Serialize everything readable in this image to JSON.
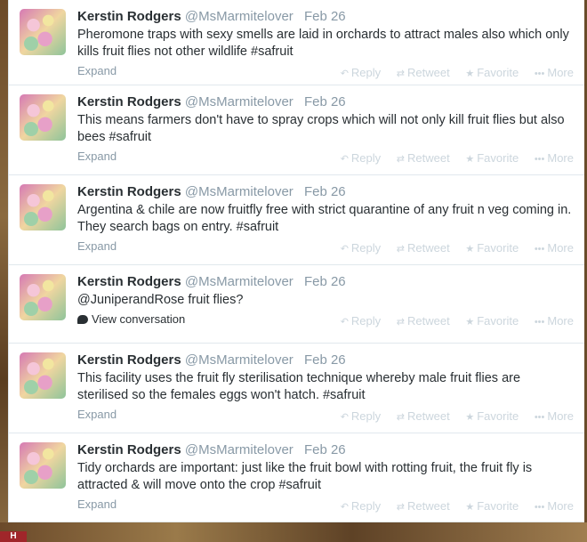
{
  "actions": {
    "reply": "Reply",
    "retweet": "Retweet",
    "favorite": "Favorite",
    "more": "More"
  },
  "icons": {
    "reply": "↶",
    "retweet": "⇄",
    "favorite": "★",
    "more": "•••"
  },
  "tweets": [
    {
      "name": "Kerstin Rodgers",
      "handle": "@MsMarmitelover",
      "date": "Feb 26",
      "text": "Pheromone traps with sexy smells are laid in orchards to attract males also which only kills fruit flies not other wildlife #safruit",
      "footer": "Expand"
    },
    {
      "name": "Kerstin Rodgers",
      "handle": "@MsMarmitelover",
      "date": "Feb 26",
      "text": "This means farmers don't have to spray crops which will not only kill fruit flies but also bees #safruit",
      "footer": "Expand"
    },
    {
      "name": "Kerstin Rodgers",
      "handle": "@MsMarmitelover",
      "date": "Feb 26",
      "text": "Argentina & chile are now fruitfly free with strict quarantine of any fruit n veg coming in. They search bags on entry.  #safruit",
      "footer": "Expand"
    },
    {
      "name": "Kerstin Rodgers",
      "handle": "@MsMarmitelover",
      "date": "Feb 26",
      "text": "@JuniperandRose fruit flies?",
      "footer": "View conversation"
    },
    {
      "name": "Kerstin Rodgers",
      "handle": "@MsMarmitelover",
      "date": "Feb 26",
      "text": "This facility uses the fruit fly sterilisation technique whereby male fruit flies are sterilised so the females eggs won't hatch. #safruit",
      "footer": "Expand"
    },
    {
      "name": "Kerstin Rodgers",
      "handle": "@MsMarmitelover",
      "date": "Feb 26",
      "text": "Tidy orchards are important: just like the fruit bowl with rotting fruit, the fruit fly is attracted & will move onto the crop #safruit",
      "footer": "Expand"
    }
  ]
}
